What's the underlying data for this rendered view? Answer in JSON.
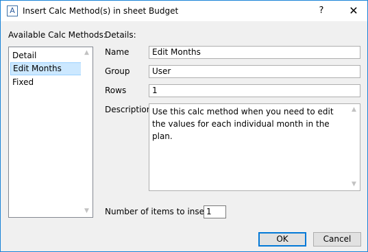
{
  "window": {
    "title": "Insert Calc Method(s) in sheet Budget",
    "app_icon_glyph": "A",
    "help_glyph": "?",
    "close_glyph": "✕"
  },
  "methods": {
    "label": "Available Calc Methods:",
    "items": [
      "Detail",
      "Edit Months",
      "Fixed"
    ],
    "selected": "Edit Months"
  },
  "details": {
    "label": "Details:",
    "name_label": "Name",
    "name_value": "Edit Months",
    "group_label": "Group",
    "group_value": "User",
    "rows_label": "Rows",
    "rows_value": "1",
    "description_label": "Description",
    "description_value": "Use this calc method when you need to edit the values for each individual month in the plan."
  },
  "insert": {
    "label": "Number of items to insert:",
    "value": "1"
  },
  "buttons": {
    "ok": "OK",
    "cancel": "Cancel"
  },
  "colors": {
    "selection": "#cce8ff",
    "accent": "#0078d7"
  }
}
